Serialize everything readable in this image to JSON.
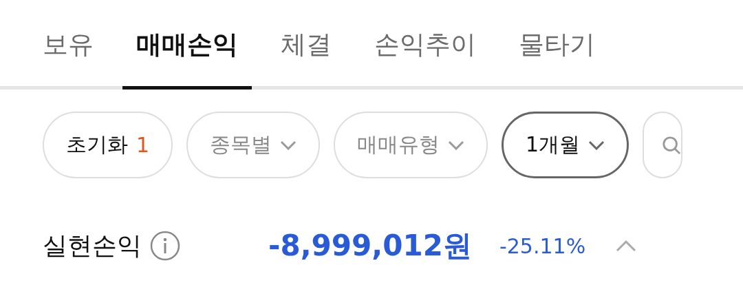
{
  "tabs": [
    {
      "label": "보유",
      "selected": false
    },
    {
      "label": "매매손익",
      "selected": true
    },
    {
      "label": "체결",
      "selected": false
    },
    {
      "label": "손익추이",
      "selected": false
    },
    {
      "label": "물타기",
      "selected": false
    }
  ],
  "filters": [
    {
      "kind": "reset",
      "label": "초기화",
      "count": "1"
    },
    {
      "kind": "dropdown",
      "label": "종목별",
      "active": false
    },
    {
      "kind": "dropdown",
      "label": "매매유형",
      "active": false
    },
    {
      "kind": "dropdown",
      "label": "1개월",
      "active": true
    },
    {
      "kind": "search"
    }
  ],
  "summary": {
    "label": "실현손익",
    "amount": "-8,999,012원",
    "rate": "-25.11%",
    "expanded": true
  }
}
